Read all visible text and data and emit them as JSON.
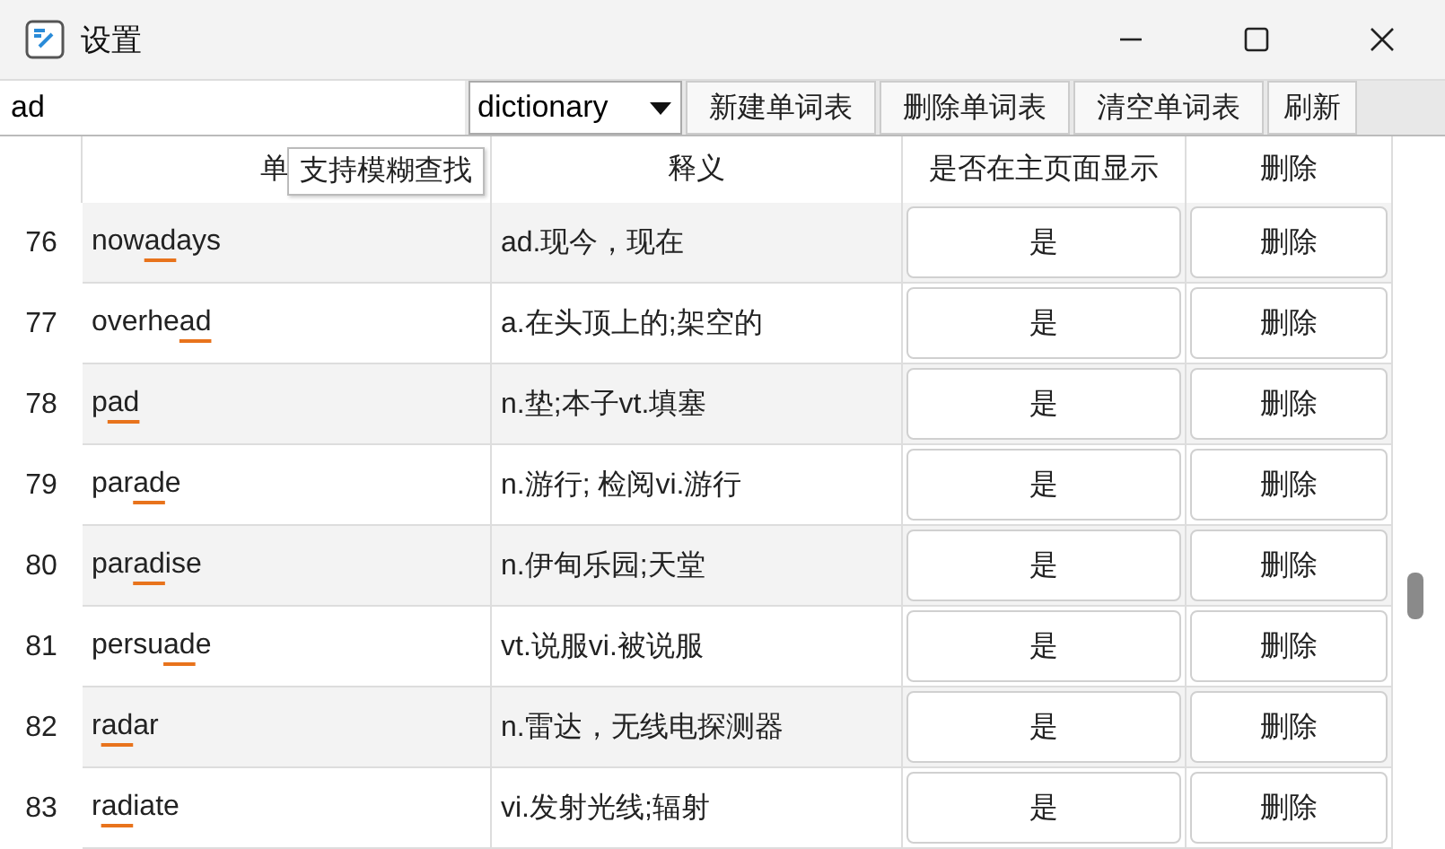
{
  "window": {
    "title": "设置"
  },
  "toolbar": {
    "search": {
      "value": "ad"
    },
    "dictionary": {
      "value": "dictionary"
    },
    "buttons": [
      "新建单词表",
      "删除单词表",
      "清空单词表",
      "刷新"
    ]
  },
  "tooltip": "支持模糊查找",
  "table": {
    "columns": [
      "单",
      "释义",
      "是否在主页面显示",
      "删除"
    ],
    "rows": [
      {
        "index": "76",
        "word": "nowadays",
        "meaning": "ad.现今，现在",
        "show": "是",
        "delete": "删除"
      },
      {
        "index": "77",
        "word": "overhead",
        "meaning": "a.在头顶上的;架空的",
        "show": "是",
        "delete": "删除"
      },
      {
        "index": "78",
        "word": "pad",
        "meaning": "n.垫;本子vt.填塞",
        "show": "是",
        "delete": "删除"
      },
      {
        "index": "79",
        "word": "parade",
        "meaning": "n.游行; 检阅vi.游行",
        "show": "是",
        "delete": "删除"
      },
      {
        "index": "80",
        "word": "paradise",
        "meaning": "n.伊甸乐园;天堂",
        "show": "是",
        "delete": "删除"
      },
      {
        "index": "81",
        "word": "persuade",
        "meaning": "vt.说服vi.被说服",
        "show": "是",
        "delete": "删除"
      },
      {
        "index": "82",
        "word": "radar",
        "meaning": "n.雷达，无线电探测器",
        "show": "是",
        "delete": "删除"
      },
      {
        "index": "83",
        "word": "radiate",
        "meaning": "vi.发射光线;辐射",
        "show": "是",
        "delete": "删除"
      }
    ]
  }
}
